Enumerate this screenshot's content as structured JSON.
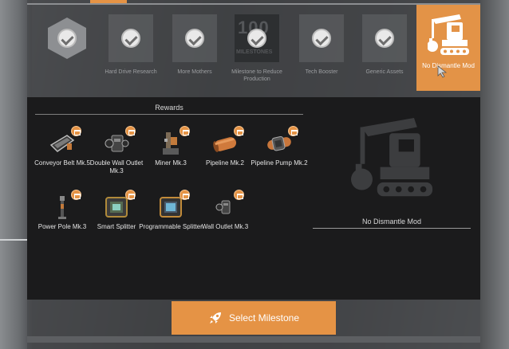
{
  "milestones": [
    {
      "label": "",
      "icon": "hexagon-check-icon",
      "style": "hex"
    },
    {
      "label": "Hard Drive Research",
      "icon": "check-icon",
      "style": "plain"
    },
    {
      "label": "More Mothers",
      "icon": "check-icon",
      "style": "plain"
    },
    {
      "label": "Milestone to Reduce Production",
      "icon": "milestone-100-icon",
      "style": "badge",
      "big_text": "100",
      "sub_text": "MILESTONES"
    },
    {
      "label": "Tech Booster",
      "icon": "check-icon",
      "style": "plain"
    },
    {
      "label": "Generic Assets",
      "icon": "check-icon",
      "style": "plain"
    }
  ],
  "selected_milestone": {
    "label": "No Dismantle Mod",
    "icon": "crane-icon"
  },
  "rewards": {
    "title": "Rewards",
    "items": [
      {
        "name": "Conveyor Belt Mk.5",
        "icon": "conveyor-belt-icon"
      },
      {
        "name": "Double Wall Outlet Mk.3",
        "icon": "double-wall-outlet-icon"
      },
      {
        "name": "Miner Mk.3",
        "icon": "miner-icon"
      },
      {
        "name": "Pipeline Mk.2",
        "icon": "pipeline-icon"
      },
      {
        "name": "Pipeline Pump Mk.2",
        "icon": "pipeline-pump-icon"
      },
      {
        "name": "Power Pole Mk.3",
        "icon": "power-pole-icon"
      },
      {
        "name": "Smart Splitter",
        "icon": "smart-splitter-icon"
      },
      {
        "name": "Programmable Splitter",
        "icon": "programmable-splitter-icon"
      },
      {
        "name": "Wall Outlet Mk.3",
        "icon": "wall-outlet-icon"
      }
    ]
  },
  "detail": {
    "name": "No Dismantle Mod",
    "icon": "crane-icon"
  },
  "select_button": {
    "label": "Select Milestone",
    "icon": "rocket-icon"
  },
  "colors": {
    "accent": "#e59345",
    "panel": "#1b1b1c"
  }
}
